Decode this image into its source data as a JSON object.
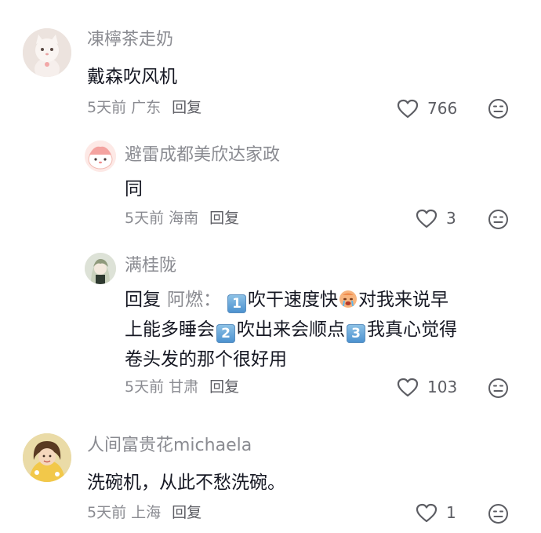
{
  "comments": [
    {
      "username": "凍檸茶走奶",
      "text": "戴森吹风机",
      "time": "5天前",
      "region": "广东",
      "reply_label": "回复",
      "likes": "766",
      "like_icon": "heart-outline-icon",
      "dislike_icon": "neutral-face-icon"
    },
    {
      "username": "避雷成都美欣达家政",
      "text": "同",
      "time": "5天前",
      "region": "海南",
      "reply_label": "回复",
      "likes": "3",
      "like_icon": "heart-outline-icon",
      "dislike_icon": "neutral-face-icon"
    },
    {
      "username": "满桂陇",
      "reply_prefix": "回复",
      "reply_to": "阿燃：",
      "badge1": "1",
      "part1": "吹干速度快",
      "part2": "对我来说早",
      "line2a": "上能多睡会",
      "badge2": "2",
      "part3": "吹出来会顺点",
      "badge3": "3",
      "part4": "我真心觉得",
      "line3": "卷头发的那个很好用",
      "time": "5天前",
      "region": "甘肃",
      "reply_label": "回复",
      "likes": "103",
      "like_icon": "heart-outline-icon",
      "dislike_icon": "neutral-face-icon"
    },
    {
      "username": "人间富贵花michaela",
      "text": "洗碗机，从此不愁洗碗。",
      "time": "5天前",
      "region": "上海",
      "reply_label": "回复",
      "likes": "1",
      "like_icon": "heart-outline-icon",
      "dislike_icon": "neutral-face-icon"
    }
  ]
}
